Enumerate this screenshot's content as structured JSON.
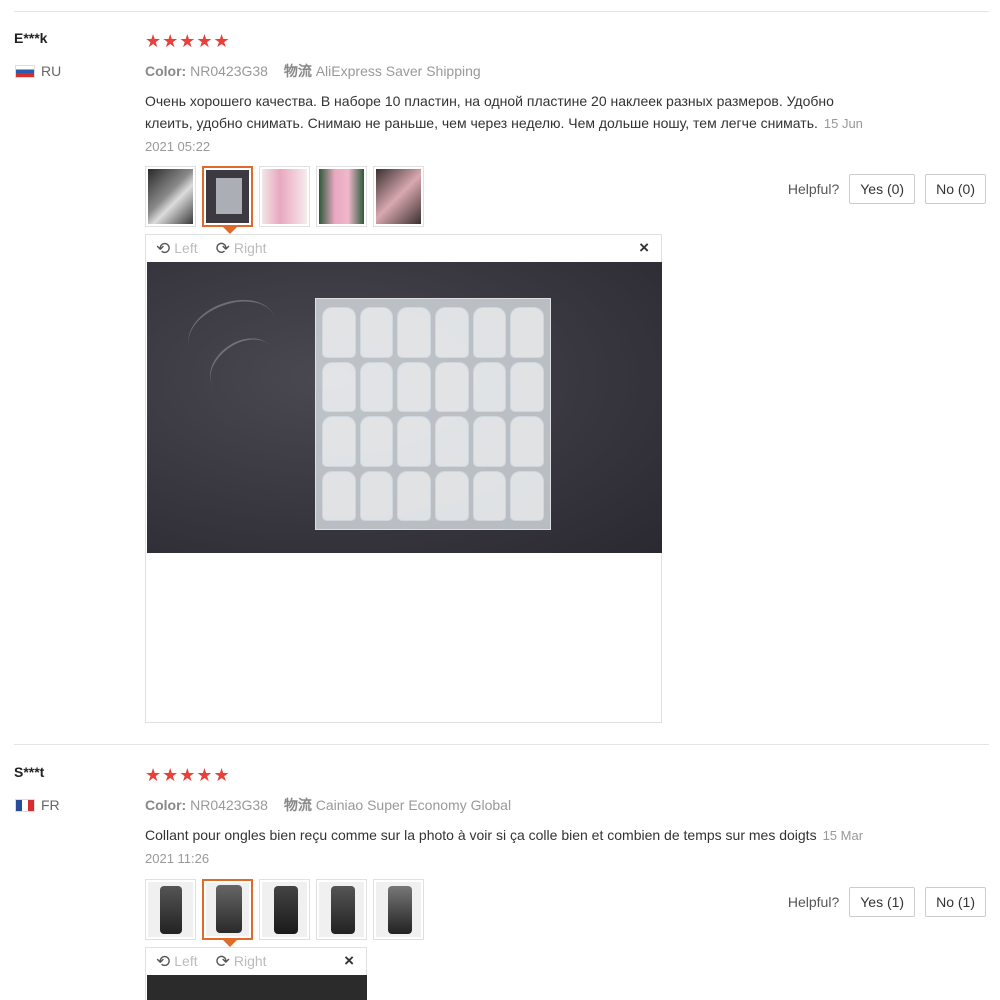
{
  "reviews": [
    {
      "user": "E***k",
      "country": "RU",
      "stars": "★★★★★",
      "color_label": "Color:",
      "color_value": "NR0423G38",
      "shipping_label": "物流",
      "shipping_value": "AliExpress Saver Shipping",
      "text": "Очень хорошего качества. В наборе 10 пластин, на одной пластине 20 наклеек разных размеров. Удобно клеить, удобно снимать. Снимаю не раньше, чем через неделю. Чем дольше ношу, тем легче снимать.",
      "date": "15 Jun 2021 05:22",
      "helpful_label": "Helpful?",
      "yes_label": "Yes (0)",
      "no_label": "No (0)",
      "viewer": {
        "left_label": "Left",
        "right_label": "Right",
        "close": "×"
      },
      "thumbs": [
        "#6a6a6a",
        "#3c3a40",
        "#e8b8c8",
        "#2e5a3a",
        "#3a3030"
      ]
    },
    {
      "user": "S***t",
      "country": "FR",
      "stars": "★★★★★",
      "color_label": "Color:",
      "color_value": "NR0423G38",
      "shipping_label": "物流",
      "shipping_value": "Cainiao Super Economy Global",
      "text": "Collant pour ongles bien reçu comme sur la photo à voir si ça colle bien et combien de temps sur mes doigts",
      "date": "15 Mar 2021 11:26",
      "helpful_label": "Helpful?",
      "yes_label": "Yes (1)",
      "no_label": "No (1)",
      "viewer": {
        "left_label": "Left",
        "right_label": "Right",
        "close": "×"
      },
      "thumbs": [
        "#444444",
        "#3a3a3a",
        "#2e2e2e",
        "#3a3a3a",
        "#4a4a4a"
      ]
    }
  ],
  "icons": {
    "rotate_left": "rotate-left-icon",
    "rotate_right": "rotate-right-icon",
    "close": "close-icon",
    "star": "star-icon"
  }
}
